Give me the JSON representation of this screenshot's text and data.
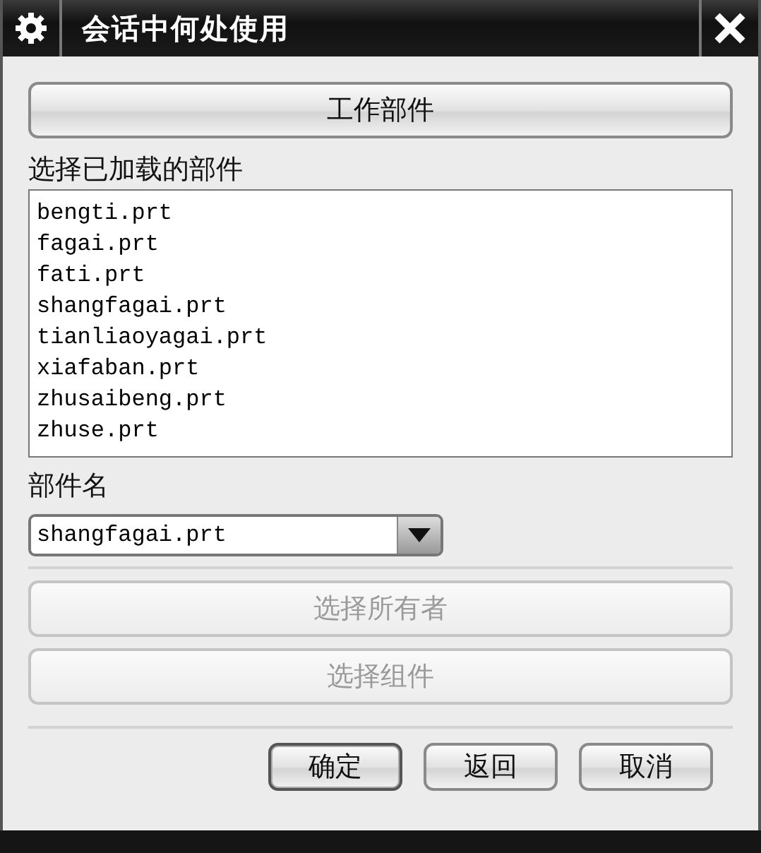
{
  "window": {
    "title": "会话中何处使用"
  },
  "work_part_button": {
    "label": "工作部件",
    "disabled": false
  },
  "loaded_parts": {
    "label": "选择已加载的部件",
    "items": [
      {
        "text": "bengti.prt"
      },
      {
        "text": "fagai.prt"
      },
      {
        "text": "fati.prt"
      },
      {
        "text": "shangfagai.prt"
      },
      {
        "text": "tianliaoyagai.prt"
      },
      {
        "text": "xiafaban.prt"
      },
      {
        "text": "zhusaibeng.prt"
      },
      {
        "text": "zhuse.prt"
      }
    ]
  },
  "part_name": {
    "label": "部件名",
    "value": "shangfagai.prt"
  },
  "action_buttons": [
    {
      "label": "选择所有者",
      "disabled": true
    },
    {
      "label": "选择组件",
      "disabled": true
    }
  ],
  "footer_buttons": [
    {
      "label": "确定",
      "default": true
    },
    {
      "label": "返回",
      "default": false
    },
    {
      "label": "取消",
      "default": false
    }
  ]
}
